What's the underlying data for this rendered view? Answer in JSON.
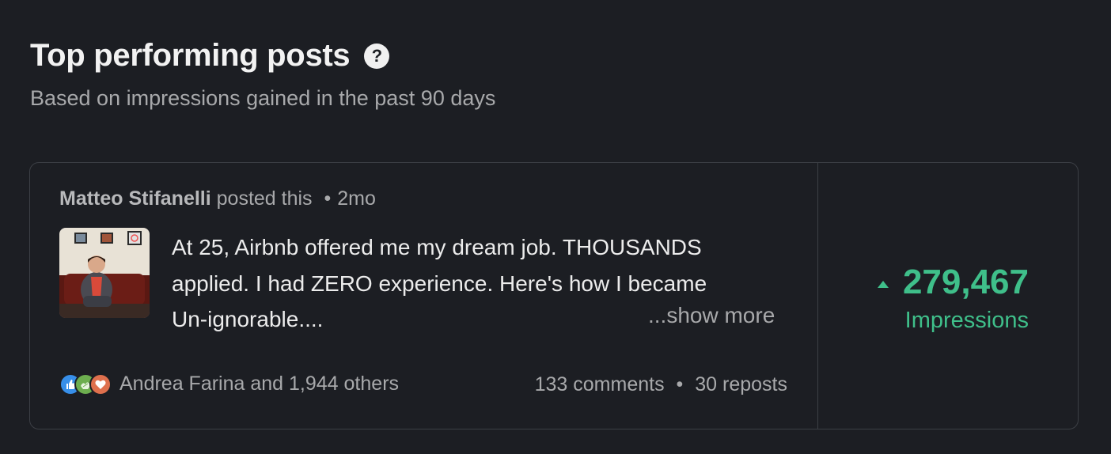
{
  "header": {
    "title": "Top performing posts",
    "help_icon": "?",
    "subtitle": "Based on impressions gained in the past 90 days"
  },
  "post": {
    "author": "Matteo Stifanelli",
    "action": "posted this",
    "separator": "•",
    "age": "2mo",
    "text_lines": [
      "At 25, Airbnb offered me my dream job. THOUSANDS",
      "applied. I had ZERO experience. Here's how I became",
      "Un-ignorable...."
    ],
    "show_more": "...show more",
    "reactions_text": "Andrea Farina and 1,944 others",
    "reaction_icons": [
      "like-icon",
      "support-icon",
      "love-icon"
    ],
    "comments": "133 comments",
    "reposts": "30 reposts"
  },
  "stats": {
    "value": "279,467",
    "label": "Impressions",
    "trend": "up"
  },
  "colors": {
    "background": "#1c1e23",
    "accent_green": "#3fbf8a",
    "muted_text": "#a8a9ab",
    "border": "#3c3f45"
  }
}
